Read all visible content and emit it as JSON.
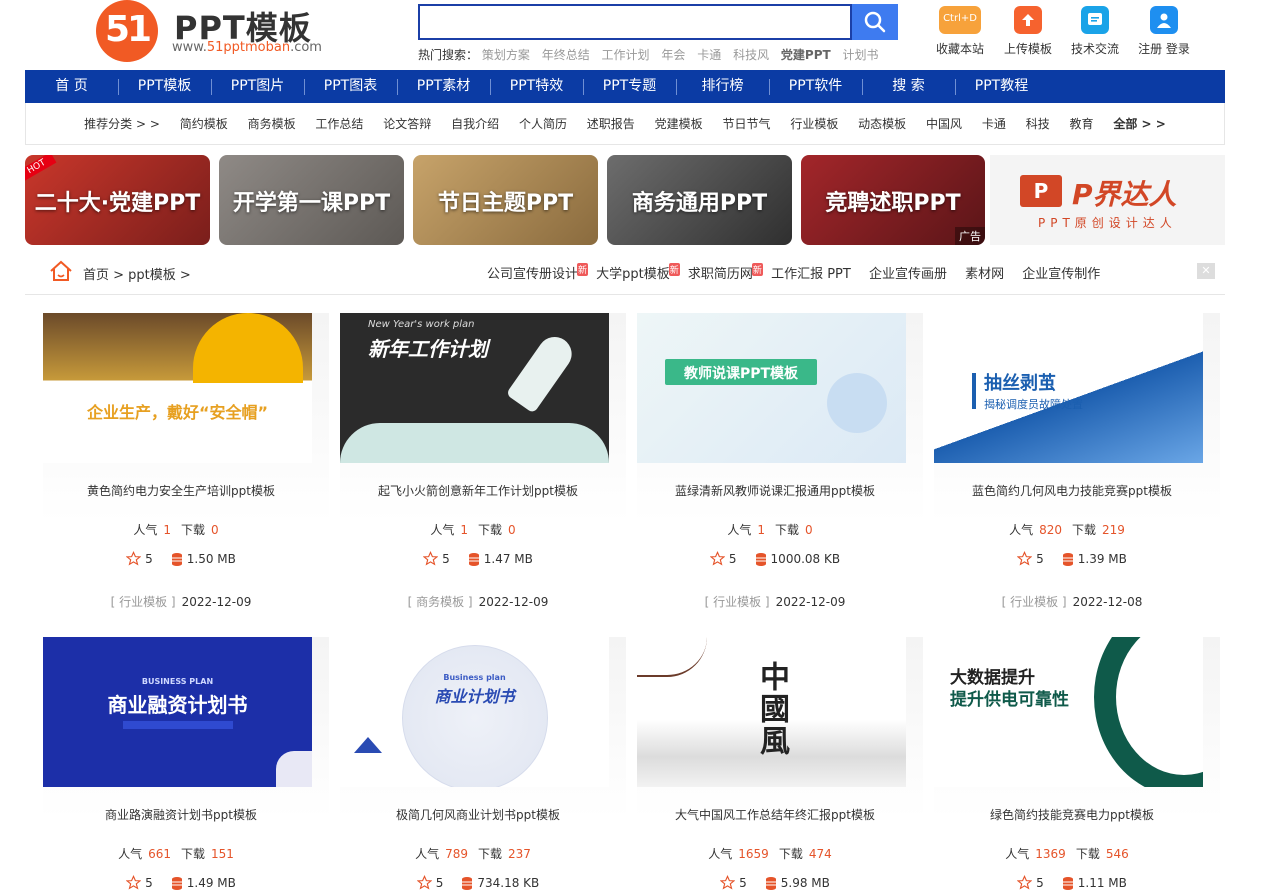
{
  "logo": {
    "mark": "51",
    "title": "PPT模板",
    "url_prefix": "www.",
    "url_brand": "51pptmoban",
    "url_suffix": ".com"
  },
  "search": {
    "value": "",
    "placeholder": ""
  },
  "hot": {
    "label": "热门搜索：",
    "items": [
      "策划方案",
      "年终总结",
      "工作计划",
      "年会",
      "卡通",
      "科技风",
      "党建PPT",
      "计划书"
    ]
  },
  "tools": [
    {
      "label": "收藏本站",
      "icon": "ctrl-d-icon",
      "badge": "Ctrl+D",
      "color": "#f7a23b"
    },
    {
      "label": "上传模板",
      "icon": "upload-icon",
      "color": "#f6622e"
    },
    {
      "label": "技术交流",
      "icon": "chat-icon",
      "color": "#1aa3e8"
    },
    {
      "label": "注册 登录",
      "icon": "user-icon",
      "color": "#1e8ff0"
    }
  ],
  "mainnav": [
    "首 页",
    "PPT模板",
    "PPT图片",
    "PPT图表",
    "PPT素材",
    "PPT特效",
    "PPT专题",
    "排行榜",
    "PPT软件",
    "搜 索",
    "PPT教程"
  ],
  "subnav": [
    "推荐分类 > >",
    "简约模板",
    "商务模板",
    "工作总结",
    "论文答辩",
    "自我介绍",
    "个人简历",
    "述职报告",
    "党建模板",
    "节日节气",
    "行业模板",
    "动态模板",
    "中国风",
    "卡通",
    "科技",
    "教育",
    "全部 > >"
  ],
  "banners": [
    {
      "text": "二十大·党建PPT",
      "hot": "HOT"
    },
    {
      "text": "开学第一课PPT"
    },
    {
      "text": "节日主题PPT"
    },
    {
      "text": "商务通用PPT"
    },
    {
      "text": "竞聘述职PPT",
      "ad": "广告"
    }
  ],
  "brand_banner": {
    "p": "P",
    "name": "P界达人",
    "slogan": "PPT原创设计达人"
  },
  "breadcrumb": "首页 > ppt模板 >",
  "topics": [
    "公司宣传册设计",
    "大学ppt模板",
    "求职简历网",
    "工作汇报 PPT",
    "企业宣传画册",
    "素材网",
    "企业宣传制作"
  ],
  "close": "✕",
  "labels": {
    "popularity": "人气",
    "downloads": "下载"
  },
  "cards": [
    {
      "title": "黄色简约电力安全生产培训ppt模板",
      "popularity": "1",
      "downloads": "0",
      "rating": "5",
      "size": "1.50 MB",
      "category": "[ 行业模板 ]",
      "date": "2022-12-09",
      "thumb": {
        "headline": "企业生产，戴好“安全帽”"
      }
    },
    {
      "title": "起飞小火箭创意新年工作计划ppt模板",
      "popularity": "1",
      "downloads": "0",
      "rating": "5",
      "size": "1.47 MB",
      "category": "[ 商务模板 ]",
      "date": "2022-12-09",
      "thumb": {
        "eyebrow": "New Year's work plan",
        "headline": "新年工作计划"
      }
    },
    {
      "title": "蓝绿清新风教师说课汇报通用ppt模板",
      "popularity": "1",
      "downloads": "0",
      "rating": "5",
      "size": "1000.08 KB",
      "category": "[ 行业模板 ]",
      "date": "2022-12-09",
      "thumb": {
        "headline": "教师说课PPT模板"
      }
    },
    {
      "title": "蓝色简约几何风电力技能竞赛ppt模板",
      "popularity": "820",
      "downloads": "219",
      "rating": "5",
      "size": "1.39 MB",
      "category": "[ 行业模板 ]",
      "date": "2022-12-08",
      "thumb": {
        "headline": "抽丝剥茧",
        "sub": "揭秘调度员故障处置"
      }
    },
    {
      "title": "商业路演融资计划书ppt模板",
      "popularity": "661",
      "downloads": "151",
      "rating": "5",
      "size": "1.49 MB",
      "thumb": {
        "eyebrow": "BUSINESS PLAN",
        "headline": "商业融资计划书"
      }
    },
    {
      "title": "极简几何风商业计划书ppt模板",
      "popularity": "789",
      "downloads": "237",
      "rating": "5",
      "size": "734.18 KB",
      "thumb": {
        "eyebrow": "Business plan",
        "headline": "商业计划书"
      }
    },
    {
      "title": "大气中国风工作总结年终汇报ppt模板",
      "popularity": "1659",
      "downloads": "474",
      "rating": "5",
      "size": "5.98 MB",
      "thumb": {
        "headline": "中國風"
      }
    },
    {
      "title": "绿色简约技能竞赛电力ppt模板",
      "popularity": "1369",
      "downloads": "546",
      "rating": "5",
      "size": "1.11 MB",
      "thumb": {
        "headline": "大数据提升",
        "sub": "提升供电可靠性"
      }
    }
  ]
}
